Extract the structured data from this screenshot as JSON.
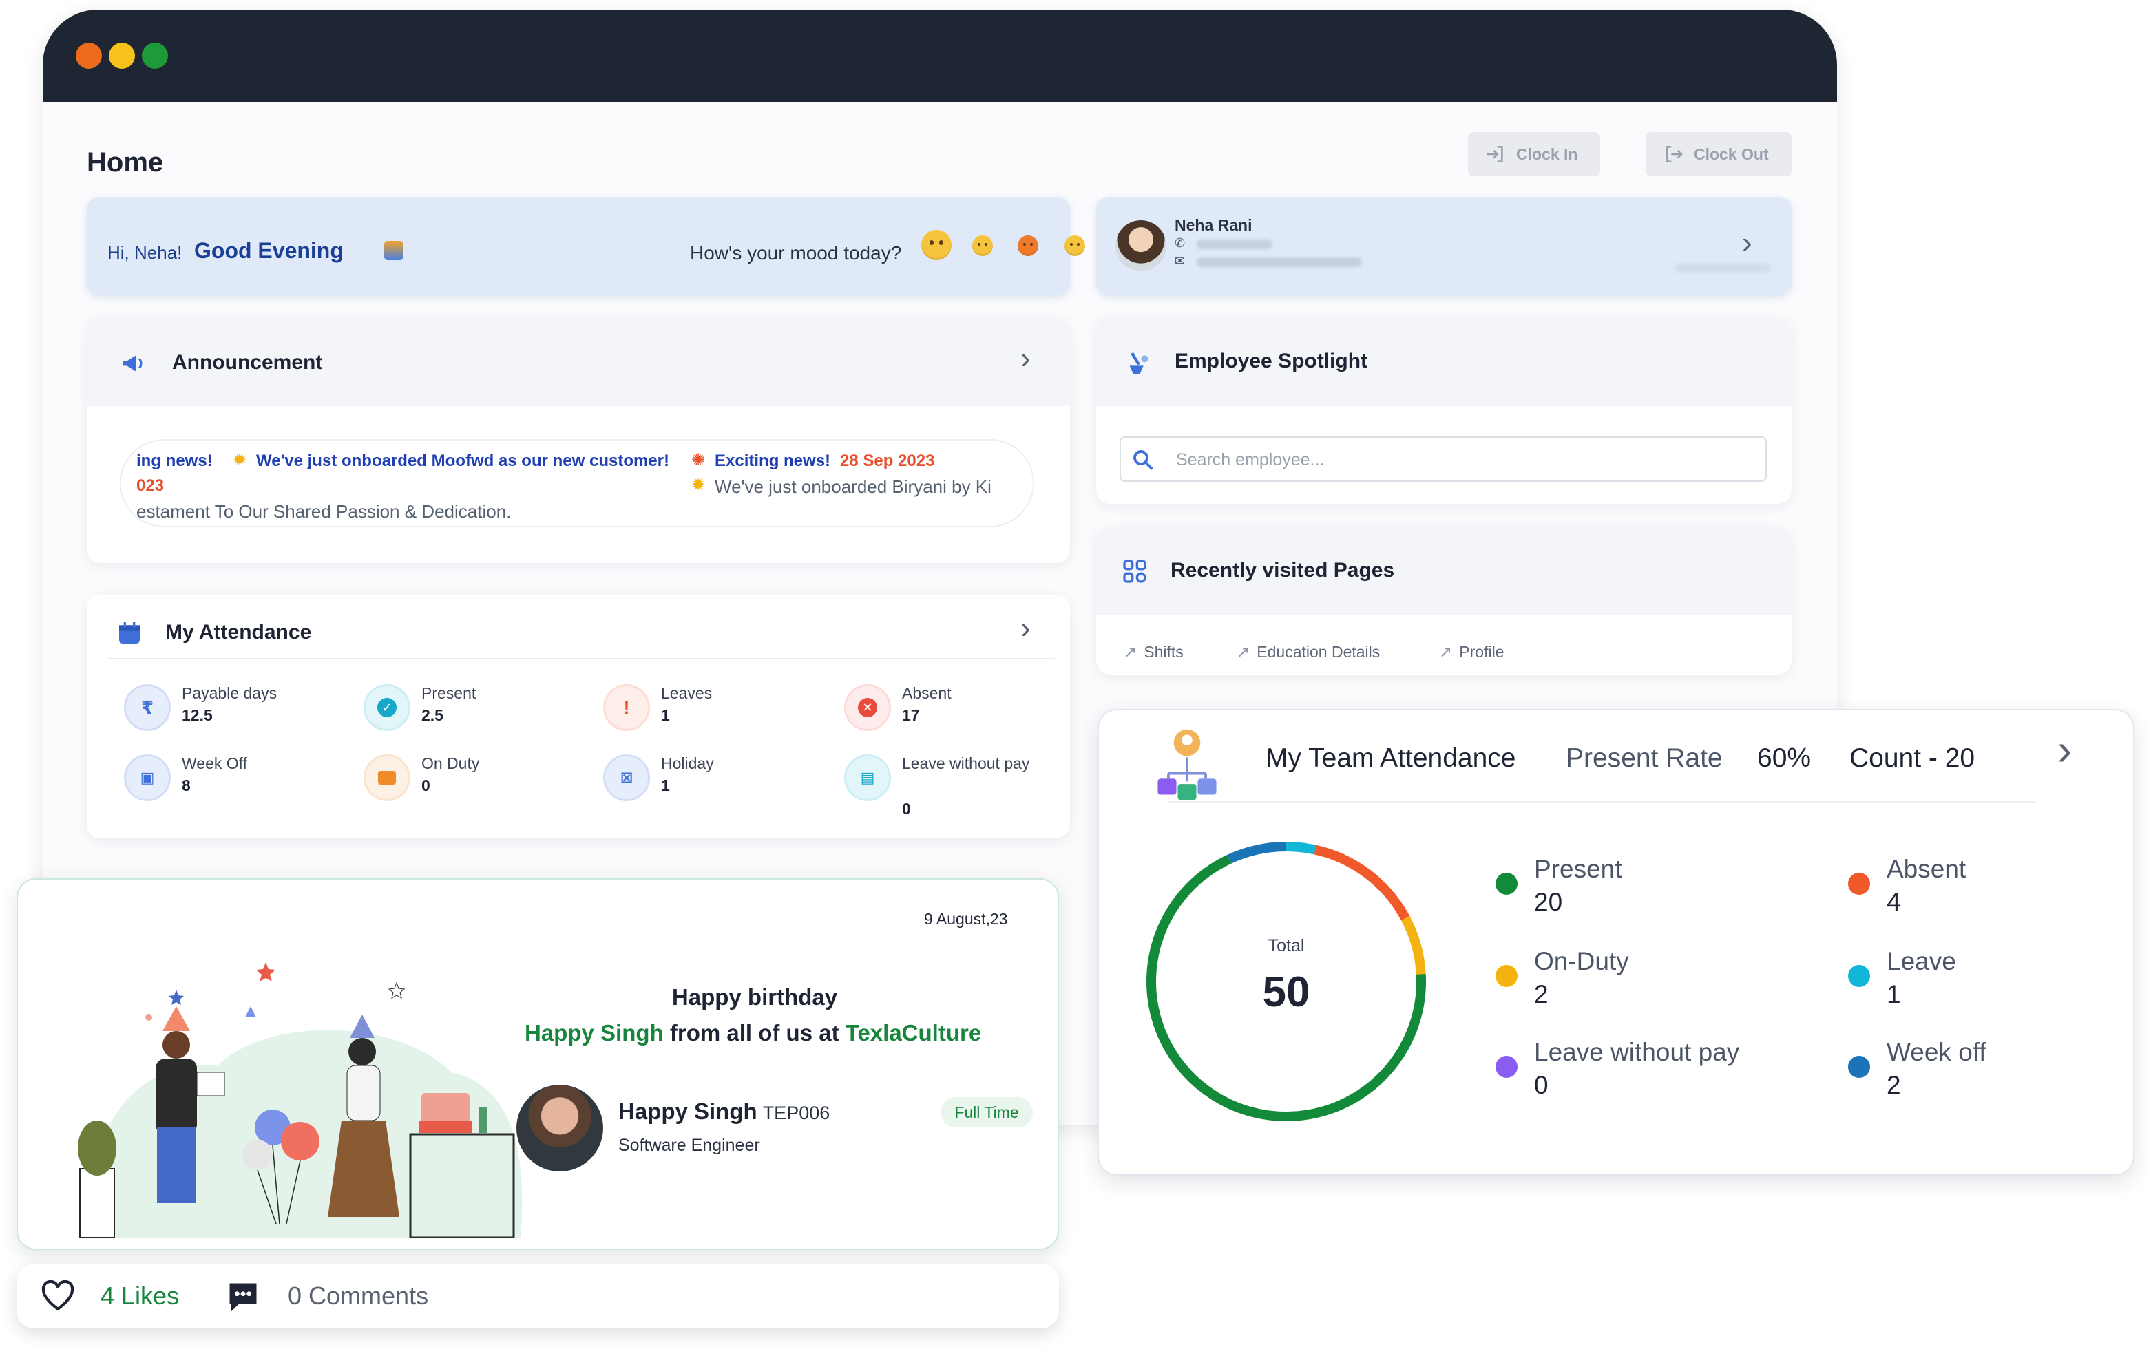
{
  "header": {
    "title": "Home",
    "clock_in": "Clock In",
    "clock_out": "Clock Out"
  },
  "greeting": {
    "hi": "Hi, Neha!",
    "time_greeting": "Good Evening",
    "mood_prompt": "How's your mood today?"
  },
  "profile": {
    "name": "Neha Rani"
  },
  "announcement": {
    "title": "Announcement",
    "items": [
      {
        "tag": "ing news!",
        "text": "We've just onboarded Moofwd as our new customer!",
        "date": "023",
        "detail": "estament To Our Shared Passion & Dedication."
      },
      {
        "tag": "Exciting news!",
        "date": "28 Sep 2023",
        "text": "We've just onboarded Biryani by Ki"
      }
    ]
  },
  "attendance": {
    "title": "My Attendance",
    "items": [
      {
        "label": "Payable days",
        "value": "12.5",
        "icon": "rupee-icon",
        "color": "#3f6fd8"
      },
      {
        "label": "Present",
        "value": "2.5",
        "icon": "check-circle-icon",
        "color": "#17a8c9"
      },
      {
        "label": "Leaves",
        "value": "1",
        "icon": "exclamation-icon",
        "color": "#e8502c"
      },
      {
        "label": "Absent",
        "value": "17",
        "icon": "x-circle-icon",
        "color": "#ea4b3c"
      },
      {
        "label": "Week Off",
        "value": "8",
        "icon": "calendar-icon",
        "color": "#3f6fd8"
      },
      {
        "label": "On Duty",
        "value": "0",
        "icon": "briefcase-icon",
        "color": "#f08a2b"
      },
      {
        "label": "Holiday",
        "value": "1",
        "icon": "calendar-x-icon",
        "color": "#3f6fd8"
      },
      {
        "label": "Leave without pay",
        "value": "0",
        "icon": "wallet-icon",
        "color": "#17a8c9"
      }
    ]
  },
  "spotlight": {
    "title": "Employee Spotlight",
    "search_placeholder": "Search employee..."
  },
  "recent": {
    "title": "Recently visited Pages",
    "links": [
      "Shifts",
      "Education Details",
      "Profile"
    ]
  },
  "birthday": {
    "date": "9 August,23",
    "line1": "Happy birthday",
    "name": "Happy Singh",
    "middle": "from all of us at",
    "company": "TexlaCulture",
    "employee_name": "Happy Singh",
    "employee_code": "TEP006",
    "role": "Software Engineer",
    "type": "Full Time"
  },
  "social": {
    "likes": "4 Likes",
    "comments": "0 Comments"
  },
  "team": {
    "title": "My Team Attendance",
    "rate_label": "Present Rate",
    "rate_value": "60%",
    "count": "Count - 20",
    "total_label": "Total",
    "total": "50",
    "legend": [
      {
        "label": "Present",
        "value": "20",
        "color": "#138a3a"
      },
      {
        "label": "Absent",
        "value": "4",
        "color": "#f05a2b"
      },
      {
        "label": "On-Duty",
        "value": "2",
        "color": "#f5b312"
      },
      {
        "label": "Leave",
        "value": "1",
        "color": "#12b6d6"
      },
      {
        "label": "Leave without pay",
        "value": "0",
        "color": "#8b5cf0"
      },
      {
        "label": "Week off",
        "value": "2",
        "color": "#1c74b8"
      }
    ]
  },
  "chart_data": {
    "type": "pie",
    "categories": [
      "Present",
      "Absent",
      "On-Duty",
      "Leave",
      "Leave without pay",
      "Week off"
    ],
    "values": [
      20,
      4,
      2,
      1,
      0,
      2
    ],
    "total": 50,
    "colors": [
      "#138a3a",
      "#f05a2b",
      "#f5b312",
      "#12b6d6",
      "#8b5cf0",
      "#1c74b8"
    ]
  }
}
